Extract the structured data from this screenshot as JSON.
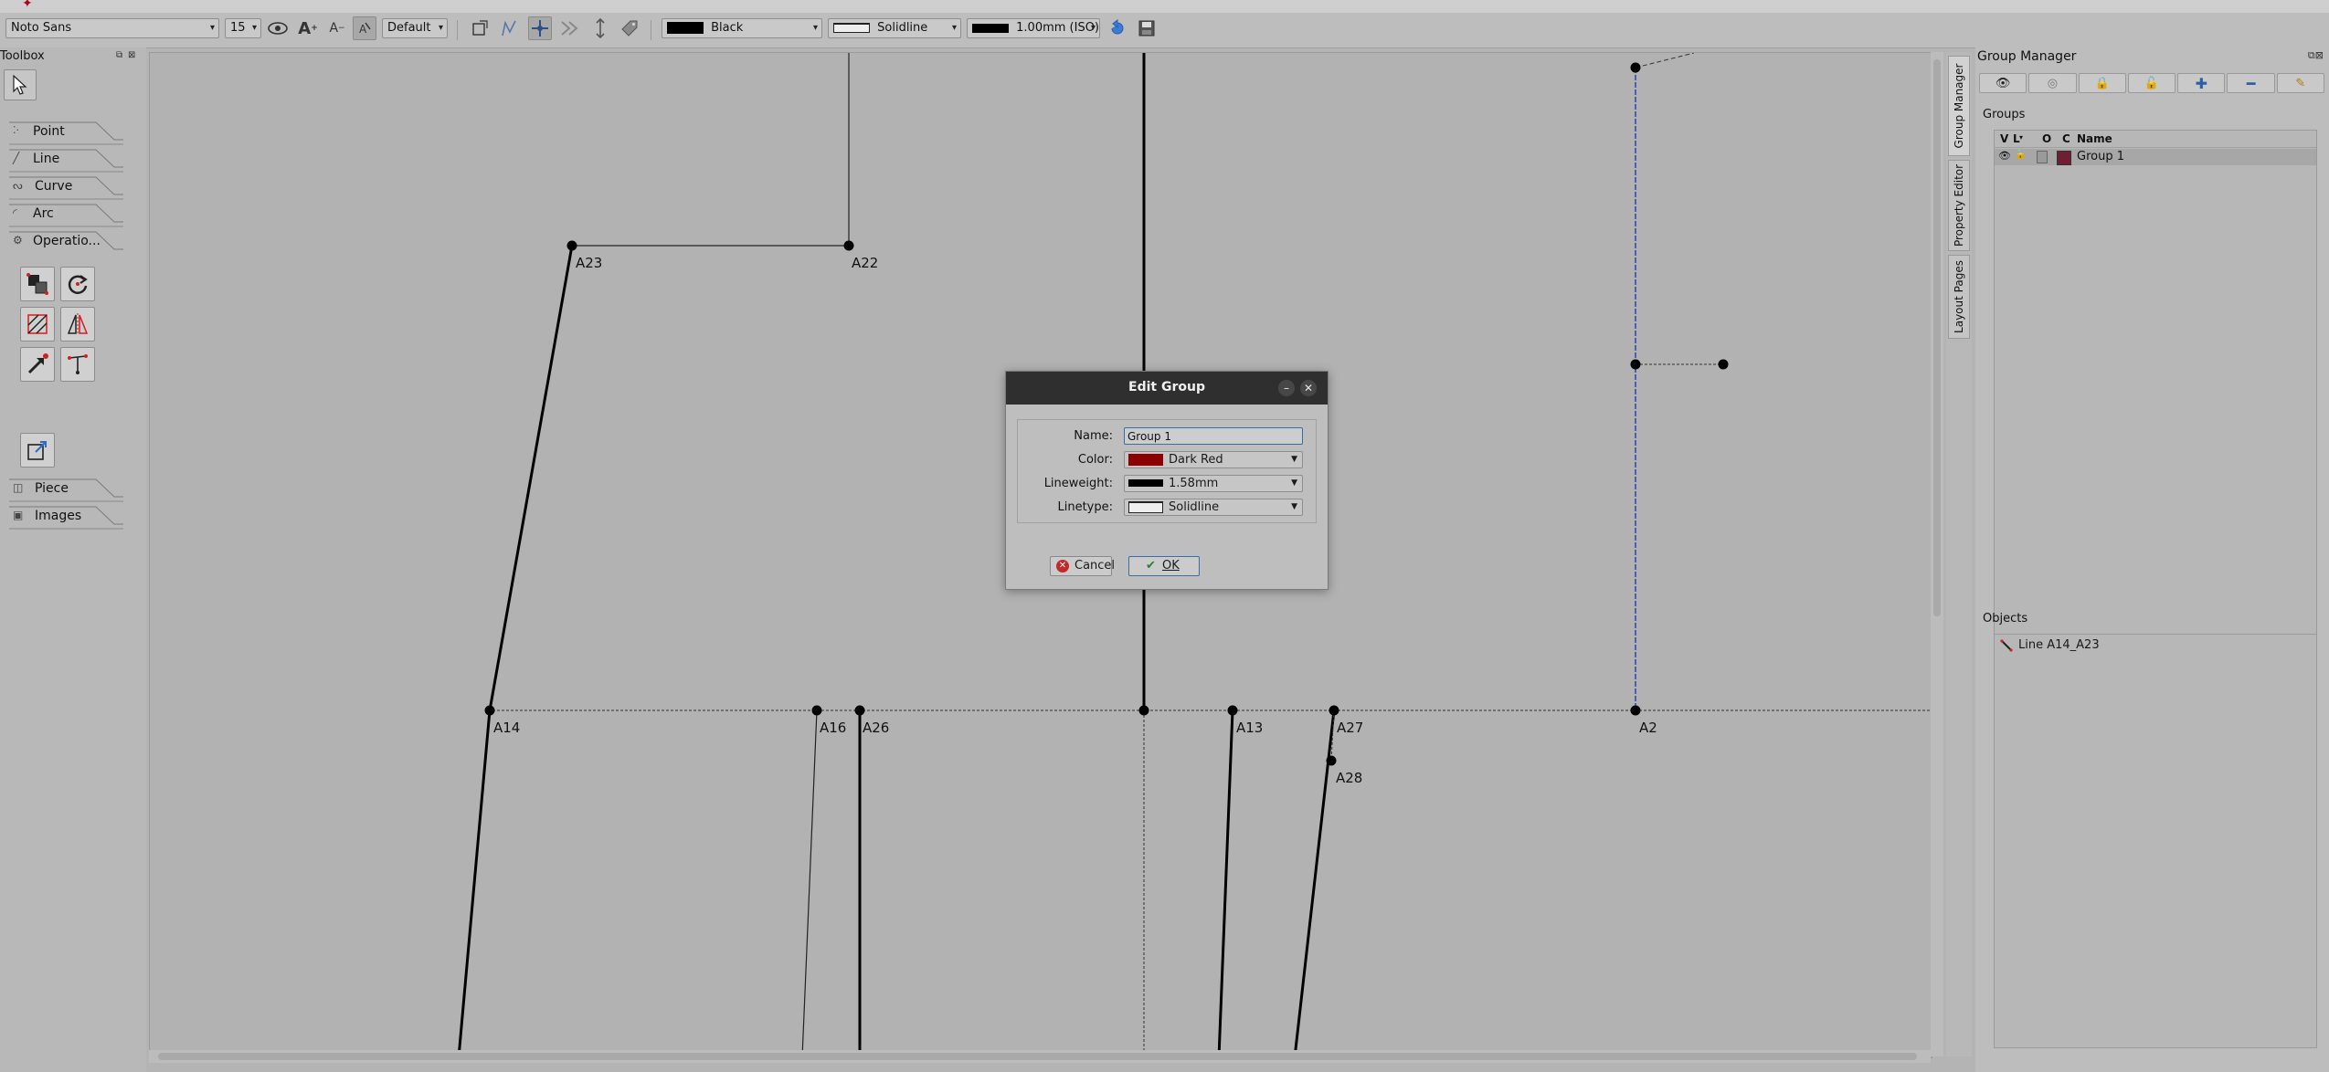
{
  "toolbar": {
    "font_family": "Noto Sans",
    "font_size": "15",
    "label_style": "Default",
    "pen_color": "Black",
    "pen_color_hex": "#000000",
    "pen_style": "Solidline",
    "pen_weight": "1.00mm (ISO)"
  },
  "toolbox": {
    "title": "Toolbox",
    "sections": [
      {
        "label": "Point"
      },
      {
        "label": "Line"
      },
      {
        "label": "Curve"
      },
      {
        "label": "Arc"
      },
      {
        "label": "Operatio..."
      },
      {
        "label": "Piece"
      },
      {
        "label": "Images"
      }
    ]
  },
  "canvas": {
    "points": [
      "A23",
      "A22",
      "A14",
      "A16",
      "A26",
      "A13",
      "A27",
      "A28",
      "A2"
    ]
  },
  "side_tabs": [
    "Group Manager",
    "Property Editor",
    "Layout Pages"
  ],
  "group_manager": {
    "title": "Group Manager",
    "groups_label": "Groups",
    "columns": {
      "v": "V",
      "l": "L",
      "o": "O",
      "c": "C",
      "name": "Name"
    },
    "rows": [
      {
        "name": "Group 1",
        "color_hex": "#6e1f34"
      }
    ],
    "objects_label": "Objects",
    "objects": [
      {
        "name": "Line A14_A23"
      }
    ]
  },
  "dialog": {
    "title": "Edit Group",
    "name_label": "Name:",
    "name_value": "Group 1",
    "color_label": "Color:",
    "color_value": "Dark Red",
    "color_hex": "#8b0000",
    "lineweight_label": "Lineweight:",
    "lineweight_value": "1.58mm",
    "linetype_label": "Linetype:",
    "linetype_value": "Solidline",
    "cancel_label": "Cancel",
    "ok_label": "OK"
  }
}
